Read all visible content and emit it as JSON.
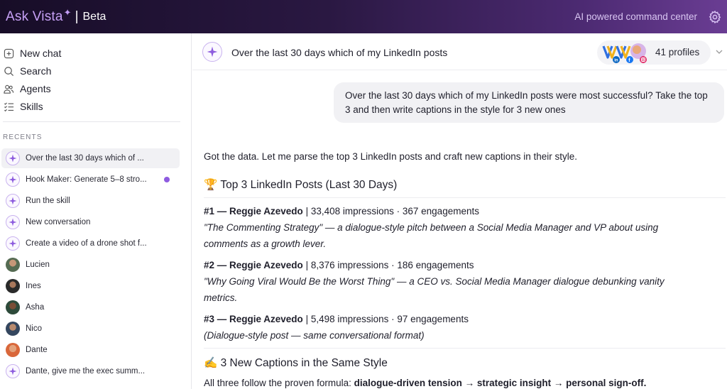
{
  "topbar": {
    "brand": "Ask Vista",
    "separator": "|",
    "beta": "Beta",
    "tagline": "AI powered command center",
    "gear_icon": "gear-icon"
  },
  "sidebar": {
    "nav": [
      {
        "label": "New chat",
        "icon": "plus-square-icon"
      },
      {
        "label": "Search",
        "icon": "search-icon"
      },
      {
        "label": "Agents",
        "icon": "people-icon"
      },
      {
        "label": "Skills",
        "icon": "checklist-icon"
      }
    ],
    "recents_label": "RECENTS",
    "recents": [
      {
        "label": "Over the last 30 days which of ...",
        "kind": "spark"
      },
      {
        "label": "Hook Maker: Generate 5–8 stro...",
        "kind": "spark"
      },
      {
        "label": "Run the skill",
        "kind": "spark"
      },
      {
        "label": "New conversation",
        "kind": "spark"
      },
      {
        "label": "Create a video of a drone shot f...",
        "kind": "spark"
      },
      {
        "label": "Lucien",
        "kind": "avatar"
      },
      {
        "label": "Ines",
        "kind": "avatar"
      },
      {
        "label": "Asha",
        "kind": "avatar"
      },
      {
        "label": "Nico",
        "kind": "avatar"
      },
      {
        "label": "Dante",
        "kind": "avatar"
      },
      {
        "label": "Dante, give me the exec summ...",
        "kind": "spark"
      }
    ]
  },
  "main": {
    "header_title": "Over the last 30 days which of my LinkedIn posts",
    "profiles_count": "41 profiles",
    "user_message": "Over the last 30 days which of my LinkedIn posts were most successful? Take the top 3 and then write captions in the style for 3 new ones",
    "intro": "Got the data. Let me parse the top 3 LinkedIn posts and craft new captions in their style.",
    "section1": {
      "emoji": "🏆",
      "title": "Top 3 LinkedIn Posts (Last 30 Days)"
    },
    "posts": [
      {
        "rank": "#1 — Reggie Azevedo",
        "stats": "| 33,408 impressions · 367 engagements",
        "line1": "\"The Commenting Strategy\" — a dialogue-style pitch between a Social Media Manager and VP about using",
        "line2": "comments as a growth lever."
      },
      {
        "rank": "#2 — Reggie Azevedo",
        "stats": "| 8,376 impressions · 186 engagements",
        "line1": "\"Why Going Viral Would Be the Worst Thing\" — a CEO vs. Social Media Manager dialogue debunking vanity",
        "line2": "metrics."
      },
      {
        "rank": "#3 — Reggie Azevedo",
        "stats": "| 5,498 impressions · 97 engagements",
        "line1": "(Dialogue-style post — same conversational format)",
        "line2": ""
      }
    ],
    "section2": {
      "emoji": "✍️",
      "title": "3 New Captions in the Same Style"
    },
    "formula_prefix": "All three follow the proven formula: ",
    "formula_bold": "dialogue-driven tension → strategic insight → personal sign-off."
  }
}
